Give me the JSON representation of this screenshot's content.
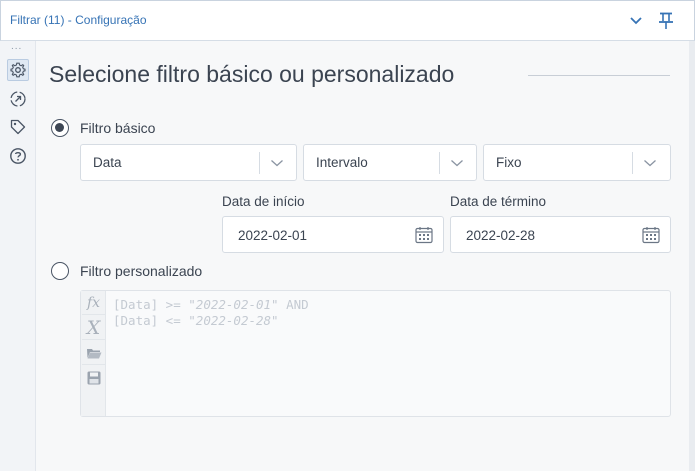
{
  "window": {
    "title": "Filtrar (11) - Configuração"
  },
  "sidebar": {
    "overflow": "...",
    "items": [
      {
        "icon": "gear-icon",
        "active": true
      },
      {
        "icon": "connection-arrow-icon",
        "active": false
      },
      {
        "icon": "tag-icon",
        "active": false
      },
      {
        "icon": "help-icon",
        "active": false
      }
    ]
  },
  "main": {
    "heading": "Selecione filtro básico ou personalizado",
    "basic": {
      "label": "Filtro básico",
      "selected": true,
      "field_select": "Data",
      "operator_select": "Intervalo",
      "mode_select": "Fixo",
      "start_label": "Data de início",
      "start_value": "2022-02-01",
      "end_label": "Data de término",
      "end_value": "2022-02-28"
    },
    "custom": {
      "label": "Filtro personalizado",
      "selected": false,
      "expression_line1_prefix": "[Data] >= ",
      "expression_line1_str": "\"2022-02-01\"",
      "expression_line1_suffix": " AND",
      "expression_line2_prefix": "[Data] <= ",
      "expression_line2_str": "\"2022-02-28\"",
      "tools": [
        {
          "icon": "fx-icon",
          "label": "fx"
        },
        {
          "icon": "variable-x-icon",
          "label": "X"
        },
        {
          "icon": "folder-open-icon"
        },
        {
          "icon": "save-icon"
        }
      ]
    }
  },
  "colors": {
    "accent": "#3673b5",
    "text": "#3b4451",
    "border": "#d6dce3",
    "background": "#f7f8f9"
  }
}
